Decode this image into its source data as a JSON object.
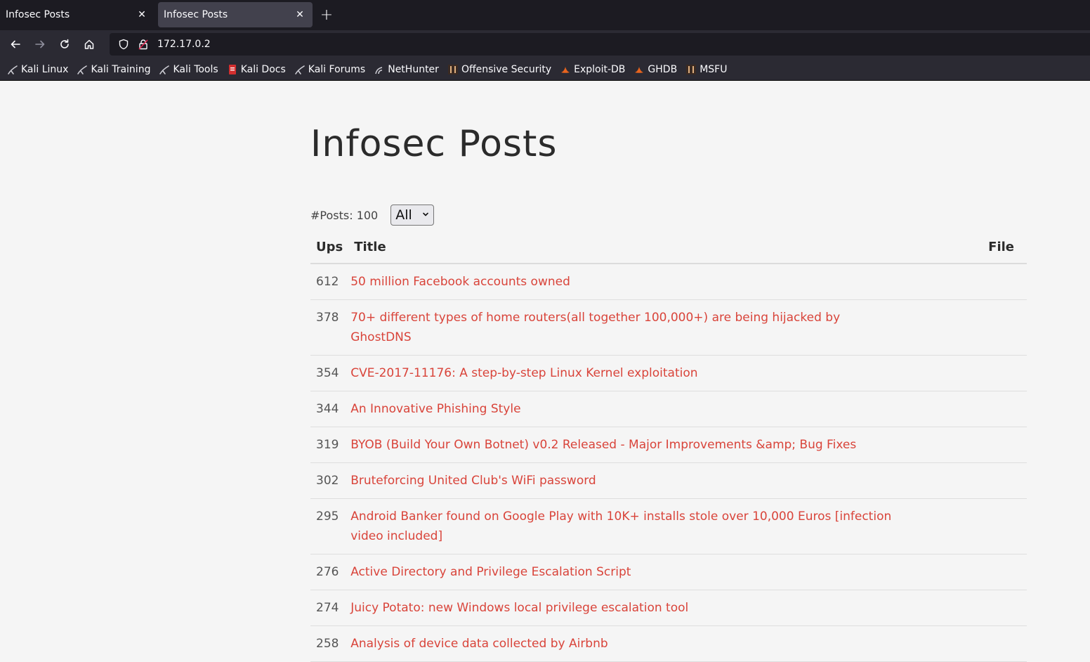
{
  "browser": {
    "tabs": [
      {
        "title": "Infosec Posts",
        "active": false
      },
      {
        "title": "Infosec Posts",
        "active": true
      }
    ],
    "url": "172.17.0.2",
    "bookmarks": [
      {
        "label": "Kali Linux",
        "icon": "kali-dragon-icon"
      },
      {
        "label": "Kali Training",
        "icon": "kali-dragon-icon"
      },
      {
        "label": "Kali Tools",
        "icon": "kali-dragon-icon"
      },
      {
        "label": "Kali Docs",
        "icon": "kali-docs-icon"
      },
      {
        "label": "Kali Forums",
        "icon": "kali-dragon-icon"
      },
      {
        "label": "NetHunter",
        "icon": "nethunter-icon"
      },
      {
        "label": "Offensive Security",
        "icon": "offsec-icon"
      },
      {
        "label": "Exploit-DB",
        "icon": "exploitdb-icon"
      },
      {
        "label": "GHDB",
        "icon": "exploitdb-icon"
      },
      {
        "label": "MSFU",
        "icon": "offsec-icon"
      }
    ]
  },
  "page": {
    "title": "Infosec Posts",
    "post_count_label": "#Posts: 100",
    "filter": {
      "selected": "All"
    },
    "table": {
      "headers": {
        "ups": "Ups",
        "title": "Title",
        "file": "File"
      },
      "rows": [
        {
          "ups": "612",
          "title": "50 million Facebook accounts owned"
        },
        {
          "ups": "378",
          "title": "70+ different types of home routers(all together 100,000+) are being hijacked by GhostDNS"
        },
        {
          "ups": "354",
          "title": "CVE-2017-11176: A step-by-step Linux Kernel exploitation"
        },
        {
          "ups": "344",
          "title": "An Innovative Phishing Style"
        },
        {
          "ups": "319",
          "title": "BYOB (Build Your Own Botnet) v0.2 Released - Major Improvements &amp; Bug Fixes"
        },
        {
          "ups": "302",
          "title": "Bruteforcing United Club's WiFi password"
        },
        {
          "ups": "295",
          "title": "Android Banker found on Google Play with 10K+ installs stole over 10,000 Euros [infection video included]"
        },
        {
          "ups": "276",
          "title": "Active Directory and Privilege Escalation Script"
        },
        {
          "ups": "274",
          "title": "Juicy Potato: new Windows local privilege escalation tool"
        },
        {
          "ups": "258",
          "title": "Analysis of device data collected by Airbnb"
        }
      ]
    }
  },
  "colors": {
    "link": "#d9443a",
    "chrome_dark": "#1c1b22",
    "chrome_mid": "#2b2a33",
    "page_bg": "#f5f5f5"
  }
}
